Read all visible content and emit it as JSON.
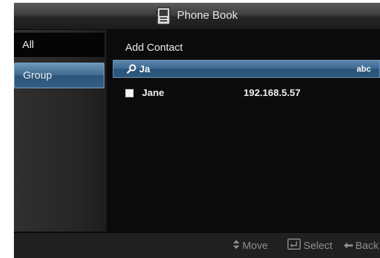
{
  "header": {
    "title": "Phone Book",
    "icon": "phone-book-icon"
  },
  "sidebar": {
    "items": [
      {
        "label": "All",
        "selected": false
      },
      {
        "label": "Group",
        "selected": true
      }
    ]
  },
  "main": {
    "add_contact_label": "Add Contact",
    "search": {
      "query": "Ja",
      "input_mode": "abc",
      "icon": "search-icon"
    },
    "contacts": [
      {
        "name": "Jane",
        "address": "192.168.5.57",
        "checked": false
      }
    ]
  },
  "footer": {
    "move": {
      "label": "Move",
      "icon": "up-down-arrows-icon"
    },
    "select": {
      "label": "Select",
      "icon": "enter-icon"
    },
    "back": {
      "label": "Back",
      "icon": "left-arrow-icon"
    }
  },
  "colors": {
    "accent": "#3d6891",
    "background": "#0b0b0b",
    "footer": "#202020"
  }
}
